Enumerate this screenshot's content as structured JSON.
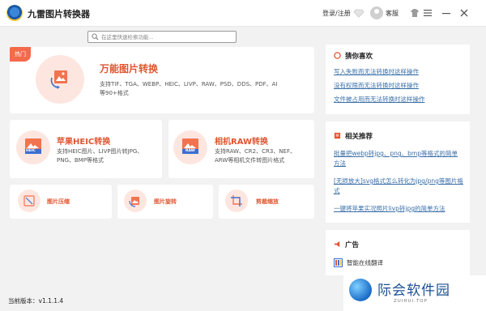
{
  "app": {
    "title": "九雷图片转换器"
  },
  "titlebar": {
    "login_label": "登录/注册",
    "username": "客服",
    "icons": [
      "vip-diamond-icon",
      "user-avatar-icon",
      "skin-shirt-icon",
      "menu-icon",
      "minimize-icon",
      "close-icon"
    ]
  },
  "search": {
    "placeholder": "在这里快速检索功能..."
  },
  "main": {
    "hot_badge": "热门",
    "universal": {
      "title": "万能图片转换",
      "desc": "支持TIF、TGA、WEBP、HEIC、LIVP、RAW、PSD、DDS、PDF、AI等90+格式"
    },
    "heic": {
      "title": "苹果HEIC转换",
      "badge": "HEIC",
      "desc": "支持HEIC图片、LIVP图片转JPG、PNG、BMP等格式"
    },
    "raw": {
      "title": "相机RAW转换",
      "badge": "RAW",
      "desc": "支持RAW、CR2、CR3、NEF、ARW等相机文件转图片格式"
    },
    "tools": [
      {
        "label": "图片压缩"
      },
      {
        "label": "图片旋转"
      },
      {
        "label": "剪裁缩放"
      }
    ]
  },
  "right_panel": {
    "guess": {
      "title": "猜你喜欢",
      "links": [
        "写入失败而无法转换时这样操作",
        "没有权限而无法转换时这样操作",
        "文件被占用而无法转换时这样操作"
      ]
    },
    "recommend": {
      "title": "相关推荐",
      "links": [
        "批量把webp转jpg、png、bmp等格式的简单方法",
        "[无损放大]svg格式怎么转化为jpg/png等图片格式",
        "一键将苹果实况照片livp转jpg的简单方法"
      ]
    },
    "ad": {
      "title": "广告",
      "item": "智能在线翻译"
    }
  },
  "status": {
    "version": "当前版本：v1.1.1.4"
  },
  "watermark": {
    "title": "际会软件园",
    "sub": "ZUIHUI.TOP"
  },
  "colors": {
    "accent": "#e0552f",
    "link": "#3a6fa8",
    "badge": "#f36a4c",
    "icon_bg": "#fde6e0"
  }
}
